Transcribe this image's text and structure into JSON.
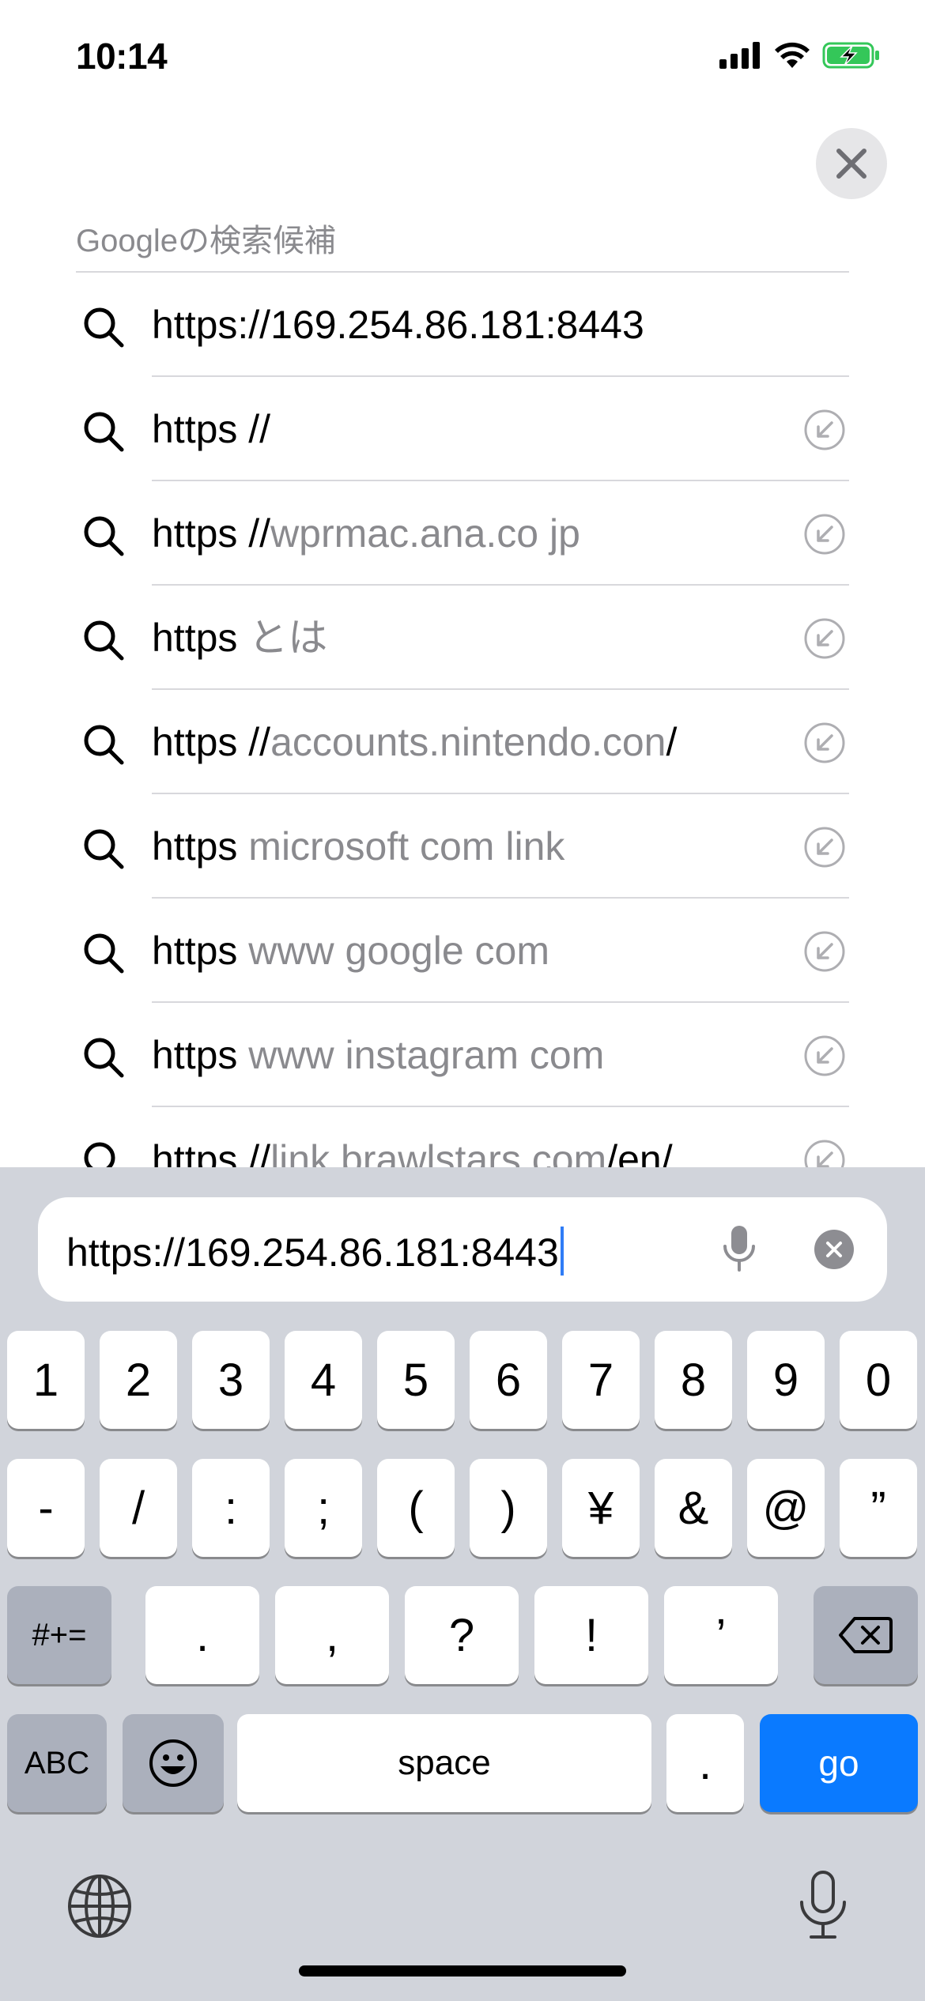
{
  "status": {
    "time": "10:14"
  },
  "header": {
    "section_title": "Googleの検索候補"
  },
  "suggestions": [
    {
      "typed": "https://169.254.86.181:8443",
      "completion": "",
      "suffix": "",
      "has_fill": false
    },
    {
      "typed": "https //",
      "completion": "",
      "suffix": "",
      "has_fill": true
    },
    {
      "typed": "https //",
      "completion": "wprmac.ana.co jp",
      "suffix": "",
      "has_fill": true
    },
    {
      "typed": "https ",
      "completion": "とは",
      "suffix": "",
      "has_fill": true
    },
    {
      "typed": "https //",
      "completion": "accounts.nintendo.con",
      "suffix": "/",
      "has_fill": true
    },
    {
      "typed": "https ",
      "completion": "microsoft com link",
      "suffix": "",
      "has_fill": true
    },
    {
      "typed": "https ",
      "completion": "www google com",
      "suffix": "",
      "has_fill": true
    },
    {
      "typed": "https ",
      "completion": "www instagram com",
      "suffix": "",
      "has_fill": true
    },
    {
      "typed": "https //",
      "completion": "link.brawlstars.com",
      "suffix": "/en/",
      "has_fill": true
    }
  ],
  "url_bar": {
    "value": "https://169.254.86.181:8443"
  },
  "keyboard": {
    "row1": [
      "1",
      "2",
      "3",
      "4",
      "5",
      "6",
      "7",
      "8",
      "9",
      "0"
    ],
    "row2": [
      "-",
      "/",
      ":",
      ";",
      "(",
      ")",
      "¥",
      "&",
      "@",
      "”"
    ],
    "row3": [
      ".",
      ",",
      "?",
      "!",
      "’"
    ],
    "symbols_toggle": "#+=",
    "abc": "ABC",
    "space": "space",
    "period": ".",
    "go": "go"
  },
  "colors": {
    "accent": "#0a7aff",
    "battery": "#34c759",
    "keyboard_bg": "#d1d4db",
    "suggestion_gray": "#8a8a8e"
  },
  "icons": {
    "status": [
      "cellular-signal-icon",
      "wifi-icon",
      "battery-charging-icon"
    ],
    "close": "close-icon",
    "search": "search-icon",
    "fill": "fill-arrow-icon",
    "mic": "microphone-icon",
    "clear": "clear-icon",
    "backspace": "backspace-icon",
    "emoji": "emoji-icon",
    "globe": "globe-icon"
  }
}
